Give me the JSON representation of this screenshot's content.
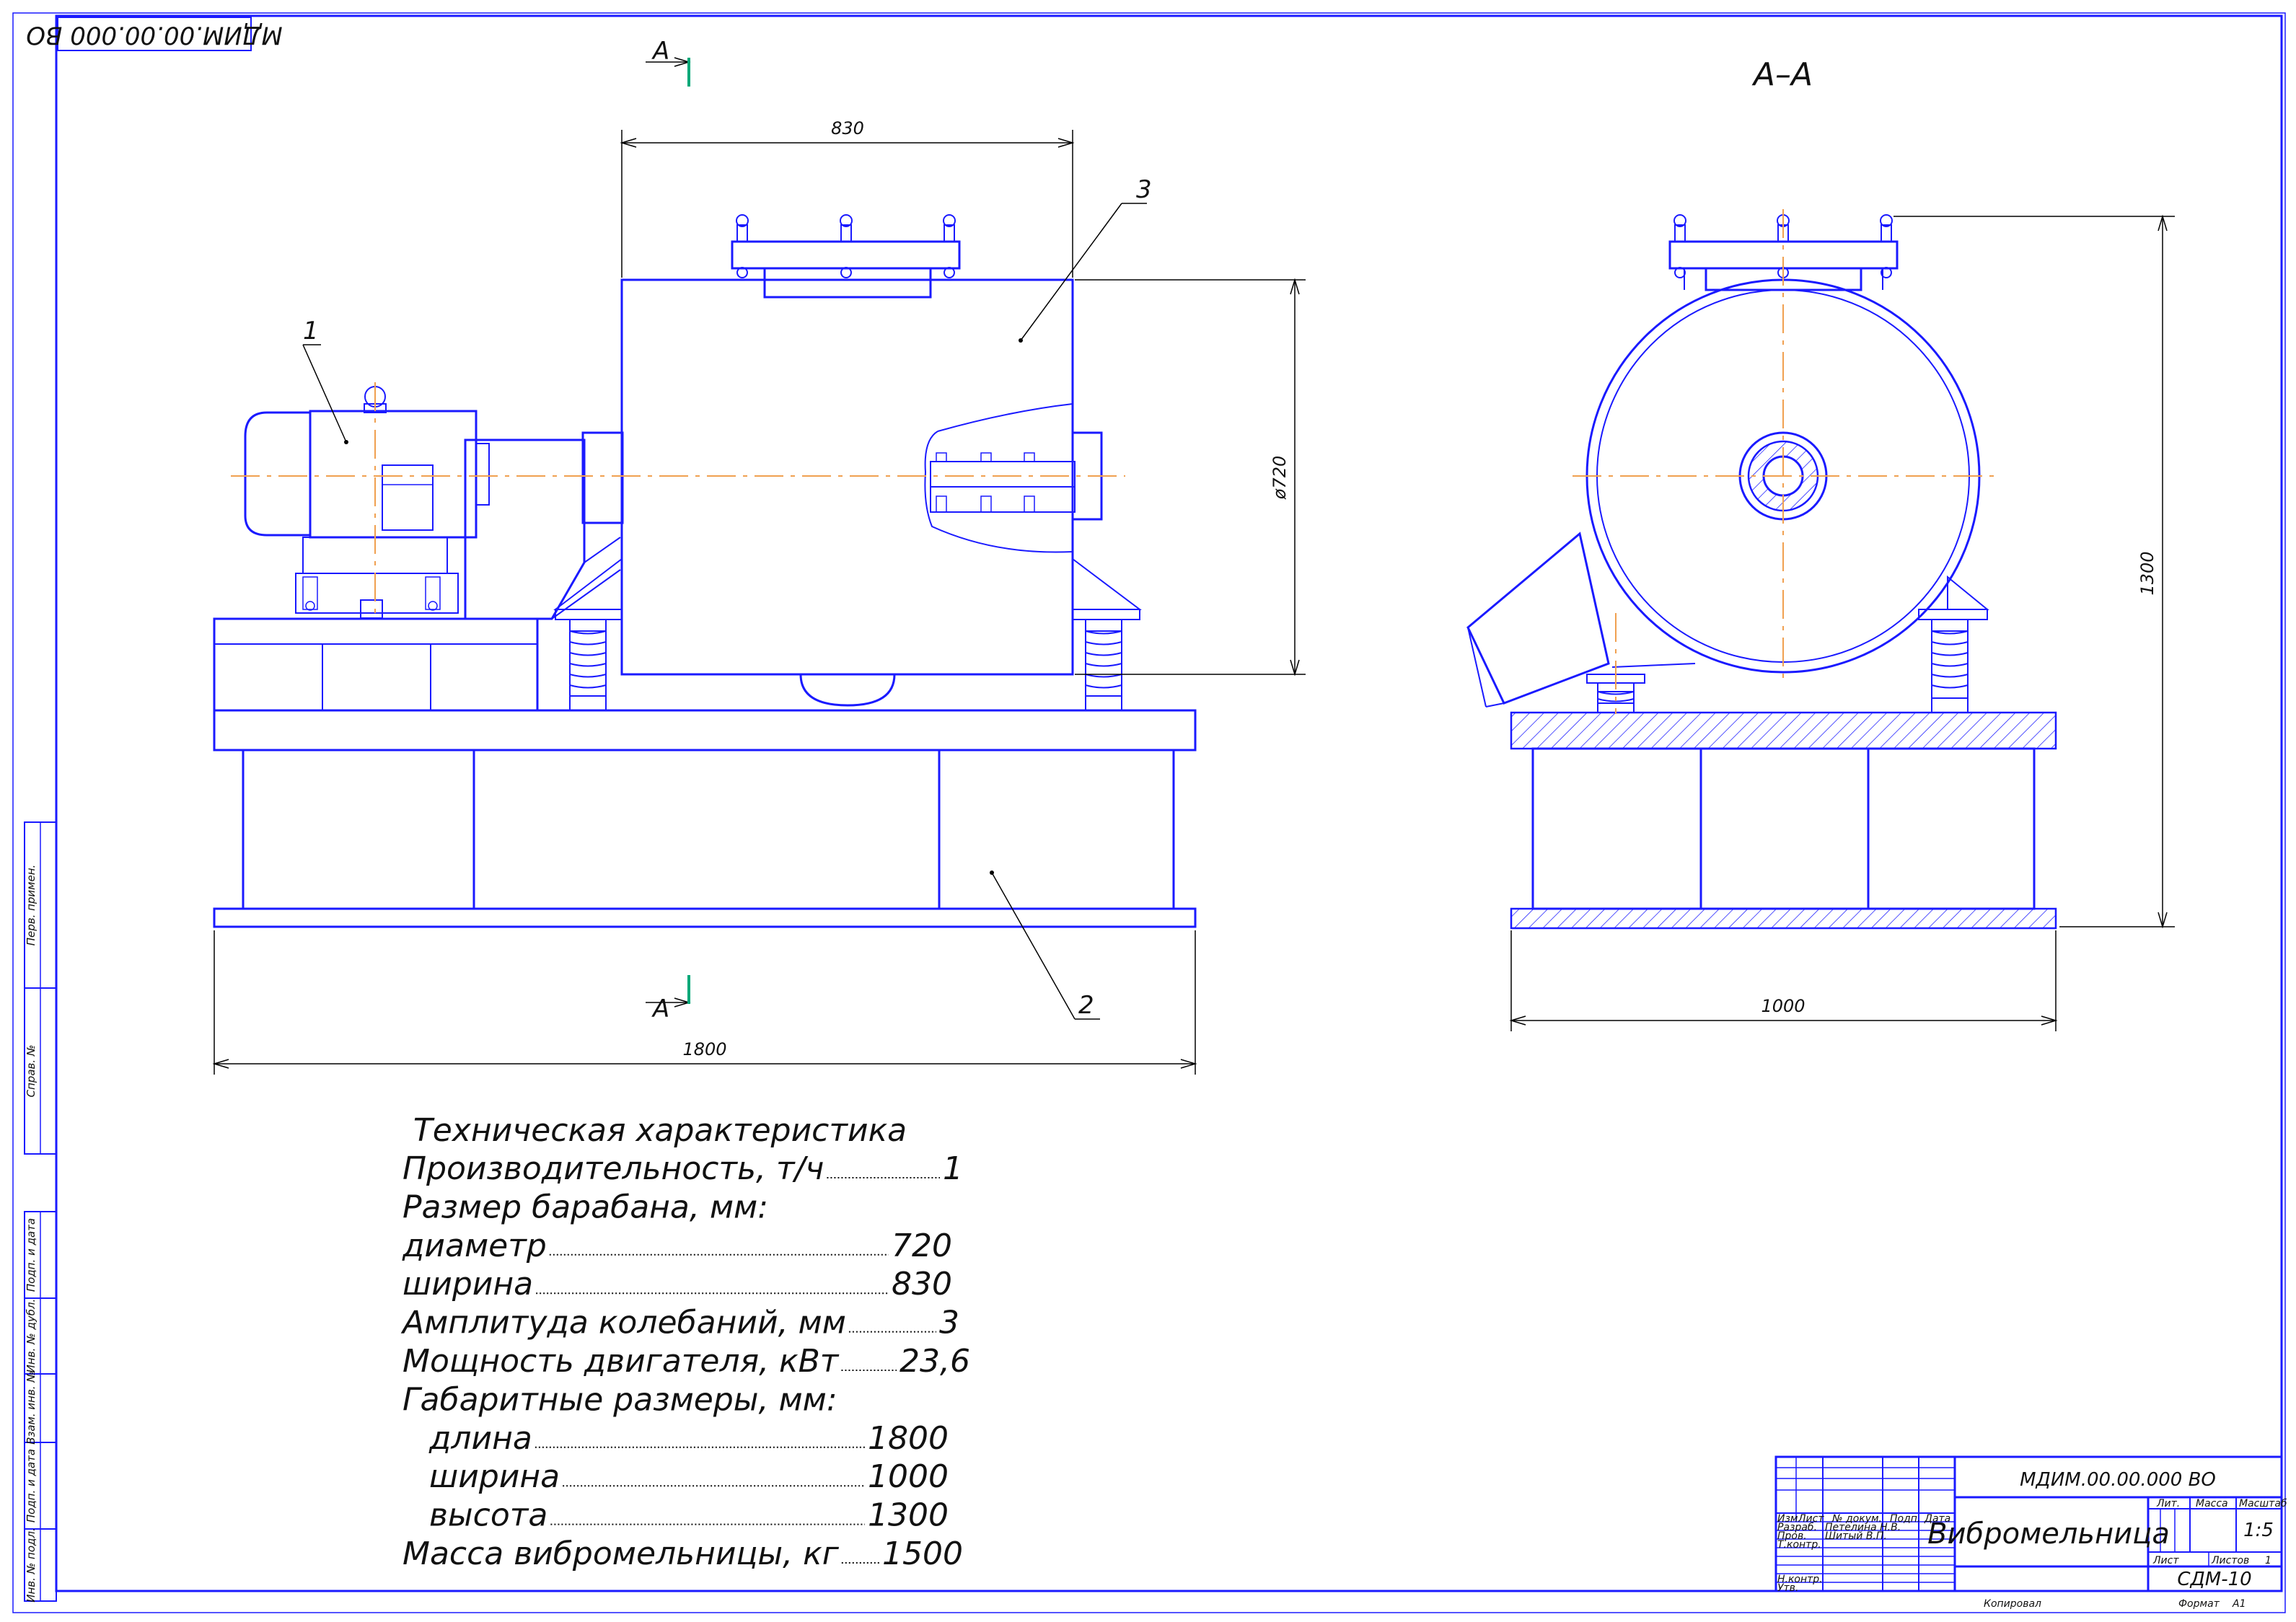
{
  "drawing": {
    "stamp_code": "МДИМ.00.00.000 ВО",
    "section_mark": "А",
    "section_title": "А–А"
  },
  "dimensions": {
    "width_830": "830",
    "diameter_720": "ø720",
    "length_1800": "1800",
    "height_1300": "1300",
    "width_1000": "1000"
  },
  "callouts": [
    "1",
    "2",
    "3"
  ],
  "spec": {
    "title": "Техническая характеристика",
    "lines": [
      {
        "label": "Производительность, т/ч",
        "value": "1"
      },
      {
        "label": "Размер барабана, мм:",
        "value": ""
      },
      {
        "label": "диаметр",
        "value": "720"
      },
      {
        "label": "ширина",
        "value": "830"
      },
      {
        "label": "Амплитуда колебаний, мм",
        "value": "3"
      },
      {
        "label": "Мощность двигателя, кВт",
        "value": "23,6"
      },
      {
        "label": "Габаритные размеры, мм:",
        "value": ""
      },
      {
        "label": "длина",
        "value": "1800"
      },
      {
        "label": "ширина",
        "value": "1000"
      },
      {
        "label": "высота",
        "value": "1300"
      },
      {
        "label": "Масса вибромельницы, кг",
        "value": "1500"
      }
    ]
  },
  "title_block": {
    "code": "МДИМ.00.00.000 ВО",
    "name": "Вибромельница",
    "org": "СДМ-10",
    "col_izm": "Изм",
    "col_list": "Лист",
    "col_doc": "№ докум.",
    "col_sign": "Подп.",
    "col_date": "Дата",
    "razrab": "Разраб.",
    "razrab_name": "Петелина Н.В.",
    "prov": "Пров.",
    "prov_name": "Шитый В.П.",
    "tkontr": "Т.контр.",
    "nkontr": "Н.контр.",
    "utv": "Утв.",
    "lit": "Лит.",
    "massa": "Масса",
    "masshtab": "Масштаб",
    "scale_value": "1:5",
    "list_label": "Лист",
    "listov_label": "Листов",
    "listov_value": "1",
    "kopiroval": "Копировал",
    "format": "Формат",
    "format_value": "А1"
  },
  "side_strip": [
    "Перв. примен.",
    "Справ. №",
    "Подп. и дата",
    "Инв. № дубл.",
    "Взам. инв. №",
    "Подп. и дата",
    "Инв. № подл."
  ]
}
